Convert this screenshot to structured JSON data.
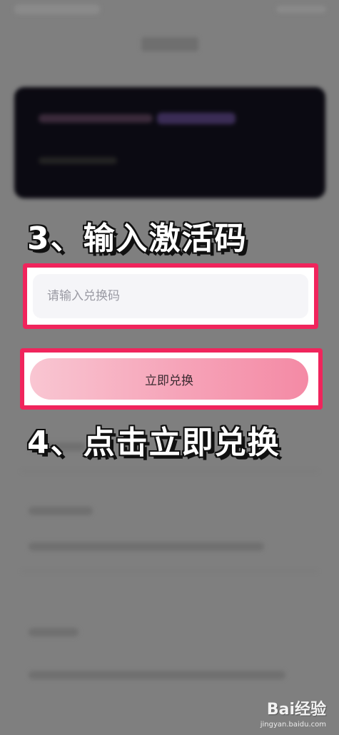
{
  "instructions": {
    "step3": "3、输入激活码",
    "step4": "4、点击立即兑换"
  },
  "redeem": {
    "input_placeholder": "请输入兑换码",
    "input_value": "",
    "button_label": "立即兑换"
  },
  "watermark": {
    "brand": "Bai经验",
    "domain": "jingyan.baidu.com"
  },
  "colors": {
    "highlight": "#f0245c",
    "button_gradient_start": "#f9c6d2",
    "button_gradient_end": "#f48aa5"
  }
}
